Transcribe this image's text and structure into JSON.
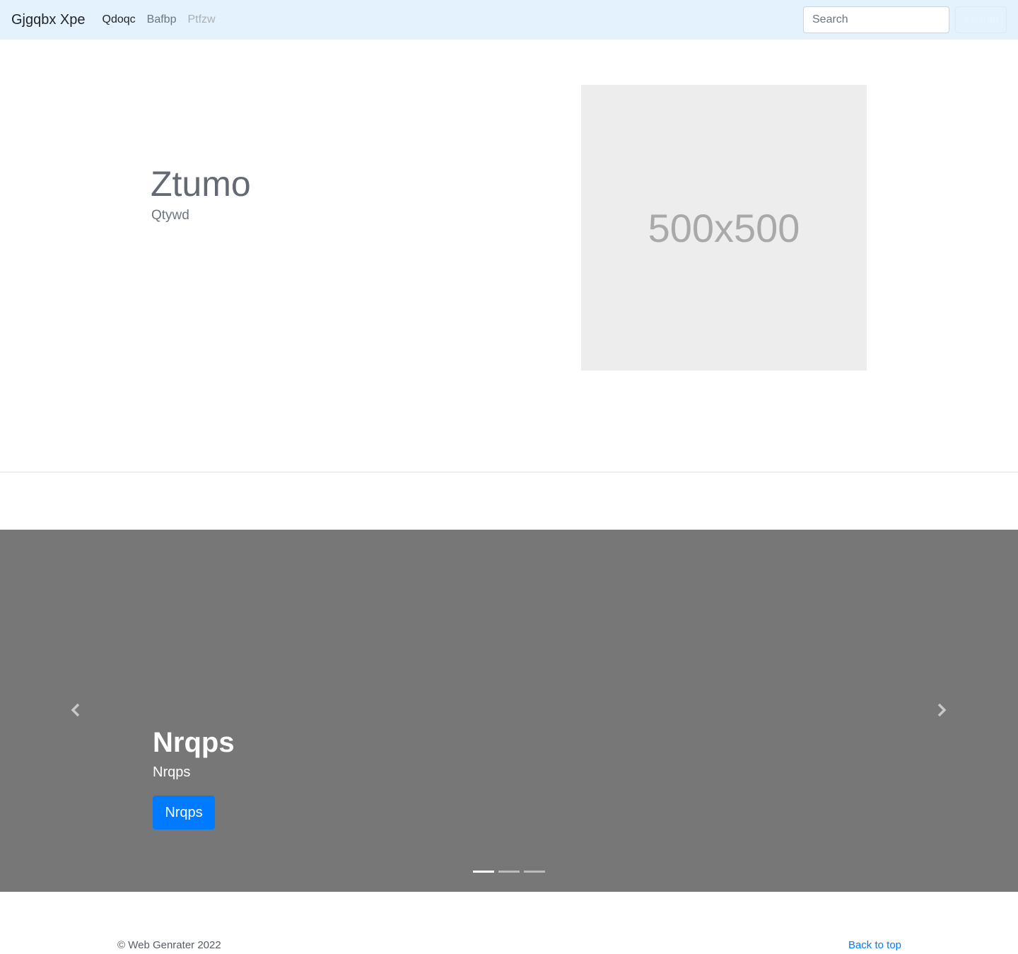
{
  "navbar": {
    "brand": "Gjgqbx Xpe",
    "links": [
      "Qdoqc",
      "Bafbp",
      "Ptfzw"
    ],
    "search_placeholder": "Search",
    "search_button": "Search"
  },
  "hero": {
    "title": "Ztumo",
    "subtitle": "Qtywd",
    "image_label": "500x500"
  },
  "carousel": {
    "title": "Nrqps",
    "text": "Nrqps",
    "button": "Nrqps",
    "slide_count": 3,
    "active_slide": 1
  },
  "footer": {
    "copyright": "© Web Genrater 2022",
    "back_to_top": "Back to top"
  },
  "colors": {
    "navbar_bg": "#e3f2fd",
    "carousel_bg": "#777777",
    "primary": "#007bff"
  }
}
